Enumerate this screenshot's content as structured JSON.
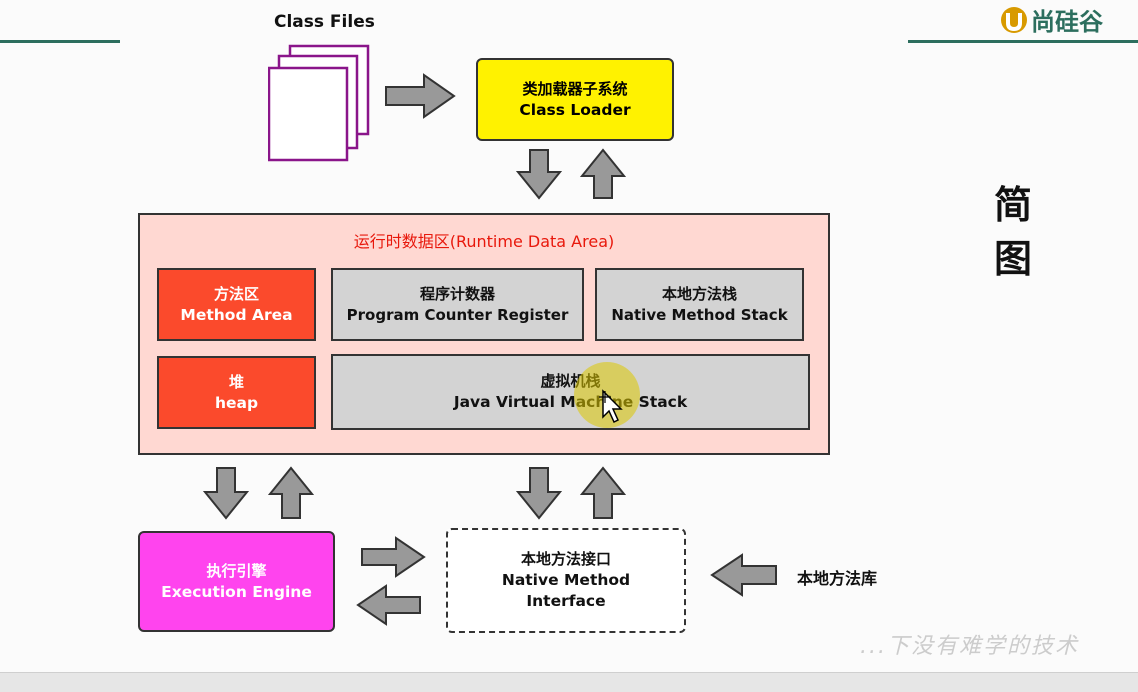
{
  "brand": {
    "logo_text": "尚硅谷",
    "accent": "#2c6e5e",
    "logo_color": "#d89a00"
  },
  "class_files": {
    "label": "Class Files"
  },
  "class_loader": {
    "cn": "类加载器子系统",
    "en": "Class Loader",
    "color": "#fff200"
  },
  "runtime_area": {
    "title": "运行时数据区(Runtime Data Area)",
    "color": "#ffd8d2",
    "method_area": {
      "cn": "方法区",
      "en": "Method Area"
    },
    "pc_register": {
      "cn": "程序计数器",
      "en": "Program Counter Register"
    },
    "native_stack": {
      "cn": "本地方法栈",
      "en": "Native Method Stack"
    },
    "heap": {
      "cn": "堆",
      "en": "heap"
    },
    "jvm_stack": {
      "cn": "虚拟机栈",
      "en": "Java Virtual Machine Stack"
    }
  },
  "execution_engine": {
    "cn": "执行引擎",
    "en": "Execution Engine",
    "color": "#ff44ee"
  },
  "native_interface": {
    "cn": "本地方法接口",
    "en1": "Native Method",
    "en2": "Interface"
  },
  "native_library": {
    "label": "本地方法库"
  },
  "side_title": {
    "line1": "简",
    "line2": "图"
  },
  "watermark": {
    "text": "...下没有难学的技术"
  },
  "colors": {
    "red_box": "#fb4a2c",
    "gray_box": "#d3d3d3",
    "arrow_fill": "#999999"
  }
}
